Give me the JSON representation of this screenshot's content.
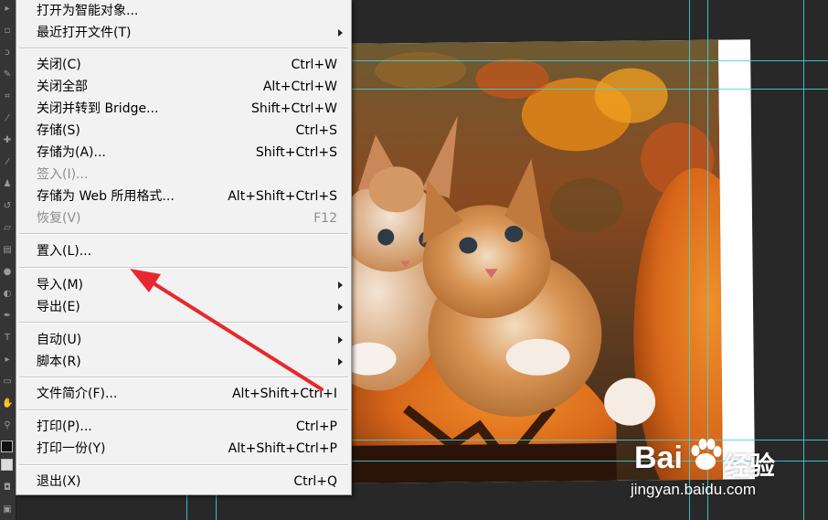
{
  "menu": {
    "items": [
      {
        "label": "打开为智能对象...",
        "shortcut": "",
        "submenu": false,
        "disabled": false
      },
      {
        "label": "最近打开文件(T)",
        "shortcut": "",
        "submenu": true,
        "disabled": false
      },
      {
        "label": "关闭(C)",
        "shortcut": "Ctrl+W",
        "submenu": false,
        "disabled": false
      },
      {
        "label": "关闭全部",
        "shortcut": "Alt+Ctrl+W",
        "submenu": false,
        "disabled": false
      },
      {
        "label": "关闭并转到 Bridge...",
        "shortcut": "Shift+Ctrl+W",
        "submenu": false,
        "disabled": false
      },
      {
        "label": "存储(S)",
        "shortcut": "Ctrl+S",
        "submenu": false,
        "disabled": false
      },
      {
        "label": "存储为(A)...",
        "shortcut": "Shift+Ctrl+S",
        "submenu": false,
        "disabled": false
      },
      {
        "label": "签入(I)...",
        "shortcut": "",
        "submenu": false,
        "disabled": true
      },
      {
        "label": "存储为 Web 所用格式...",
        "shortcut": "Alt+Shift+Ctrl+S",
        "submenu": false,
        "disabled": false
      },
      {
        "label": "恢复(V)",
        "shortcut": "F12",
        "submenu": false,
        "disabled": true
      },
      {
        "label": "置入(L)...",
        "shortcut": "",
        "submenu": false,
        "disabled": false
      },
      {
        "label": "导入(M)",
        "shortcut": "",
        "submenu": true,
        "disabled": false
      },
      {
        "label": "导出(E)",
        "shortcut": "",
        "submenu": true,
        "disabled": false
      },
      {
        "label": "自动(U)",
        "shortcut": "",
        "submenu": true,
        "disabled": false
      },
      {
        "label": "脚本(R)",
        "shortcut": "",
        "submenu": true,
        "disabled": false
      },
      {
        "label": "文件简介(F)...",
        "shortcut": "Alt+Shift+Ctrl+I",
        "submenu": false,
        "disabled": false
      },
      {
        "label": "打印(P)...",
        "shortcut": "Ctrl+P",
        "submenu": false,
        "disabled": false
      },
      {
        "label": "打印一份(Y)",
        "shortcut": "Alt+Shift+Ctrl+P",
        "submenu": false,
        "disabled": false
      },
      {
        "label": "退出(X)",
        "shortcut": "Ctrl+Q",
        "submenu": false,
        "disabled": false
      }
    ]
  },
  "annotation": {
    "color": "#e8282e"
  },
  "guides": {
    "color": "#3fd6e0"
  },
  "watermark": {
    "brand_left": "Bai",
    "brand_right": "经验",
    "url": "jingyan.baidu.com"
  },
  "icons": [
    "paw-icon",
    "submenu-arrow-icon",
    "tool-icon"
  ]
}
